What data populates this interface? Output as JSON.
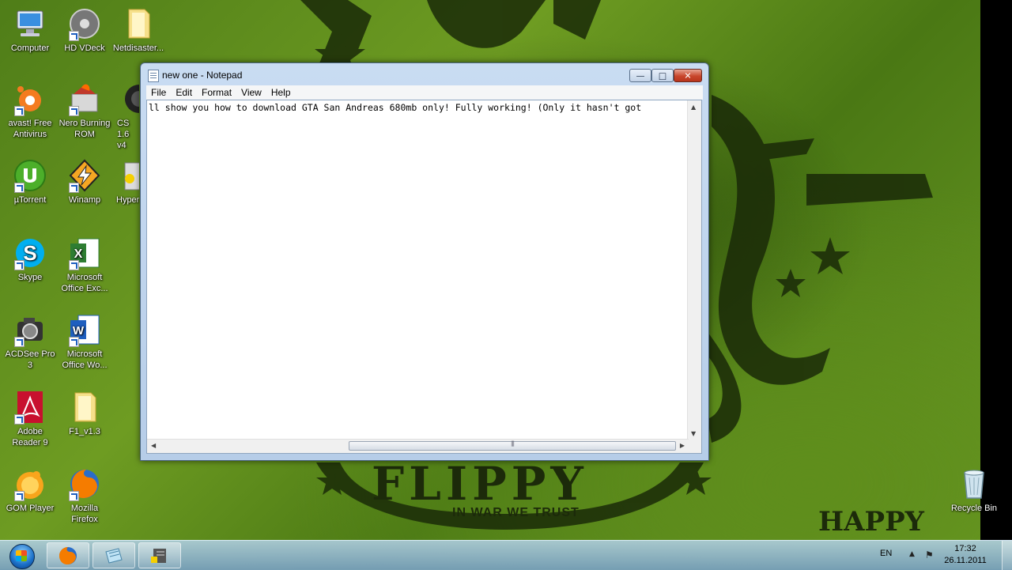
{
  "desktop": {
    "icons": [
      {
        "label": "Computer",
        "icon": "computer-icon"
      },
      {
        "label": "HD VDeck",
        "icon": "hd-vdeck-icon"
      },
      {
        "label": "Netdisaster...",
        "icon": "folder-icon"
      },
      {
        "label": "avast! Free Antivirus",
        "icon": "avast-icon"
      },
      {
        "label": "Nero Burning ROM",
        "icon": "nero-icon"
      },
      {
        "label": "CS 1.6 v4",
        "icon": "counter-strike-icon"
      },
      {
        "label": "µTorrent",
        "icon": "utorrent-icon"
      },
      {
        "label": "Winamp",
        "icon": "winamp-icon"
      },
      {
        "label": "Hyper",
        "icon": "hyper-icon"
      },
      {
        "label": "Skype",
        "icon": "skype-icon"
      },
      {
        "label": "Microsoft Office Exc...",
        "icon": "excel-icon"
      },
      {
        "label": "ACDSee Pro 3",
        "icon": "acdsee-icon"
      },
      {
        "label": "Microsoft Office Wo...",
        "icon": "word-icon"
      },
      {
        "label": "Adobe Reader 9",
        "icon": "adobe-reader-icon"
      },
      {
        "label": "F1_v1.3",
        "icon": "folder-icon"
      },
      {
        "label": "GOM Player",
        "icon": "gom-player-icon"
      },
      {
        "label": "Mozilla Firefox",
        "icon": "firefox-icon"
      },
      {
        "label": "Recycle Bin",
        "icon": "recycle-bin-icon"
      }
    ],
    "wallpaper": {
      "headline": "FLIPPY",
      "tagline": "IN WAR WE TRUST",
      "corner_text": "HAPPY"
    }
  },
  "notepad": {
    "title": "new one - Notepad",
    "menu": [
      "File",
      "Edit",
      "Format",
      "View",
      "Help"
    ],
    "content": "ll show you how to download GTA San Andreas 680mb only! Fully working! (Only it hasn't got",
    "buttons": {
      "minimize": "—",
      "maximize": "□",
      "close": "✕"
    }
  },
  "taskbar": {
    "apps": [
      "firefox-icon",
      "notepad-icon",
      "counter-strike-icon"
    ],
    "language": "EN",
    "time": "17:32",
    "date": "26.11.2011"
  },
  "colors": {
    "wallpaper_green": "#5f8e1c",
    "taskbar": "#9fc2e0",
    "close_red": "#c8462c"
  }
}
